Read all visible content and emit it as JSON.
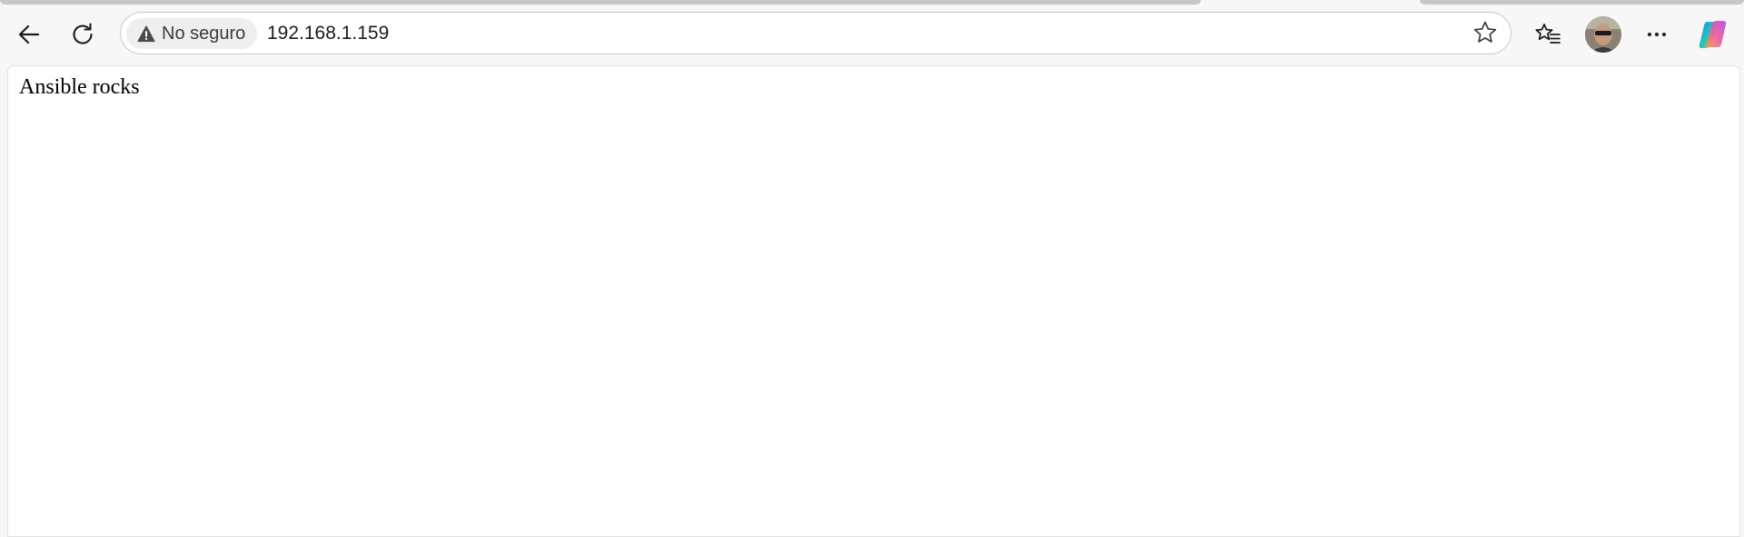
{
  "security": {
    "label": "No seguro"
  },
  "address_bar": {
    "url": "192.168.1.159"
  },
  "page": {
    "body_text": "Ansible rocks"
  },
  "icons": {
    "back": "back-arrow-icon",
    "reload": "reload-icon",
    "warning": "warning-triangle-icon",
    "favorite": "star-icon",
    "favorites": "favorites-list-icon",
    "profile": "avatar",
    "more": "more-options-icon",
    "copilot": "copilot-icon"
  },
  "colors": {
    "toolbar_bg": "#f7f7f7",
    "address_bg": "#ffffff",
    "chip_bg": "#eeeeee",
    "page_bg": "#ffffff"
  }
}
